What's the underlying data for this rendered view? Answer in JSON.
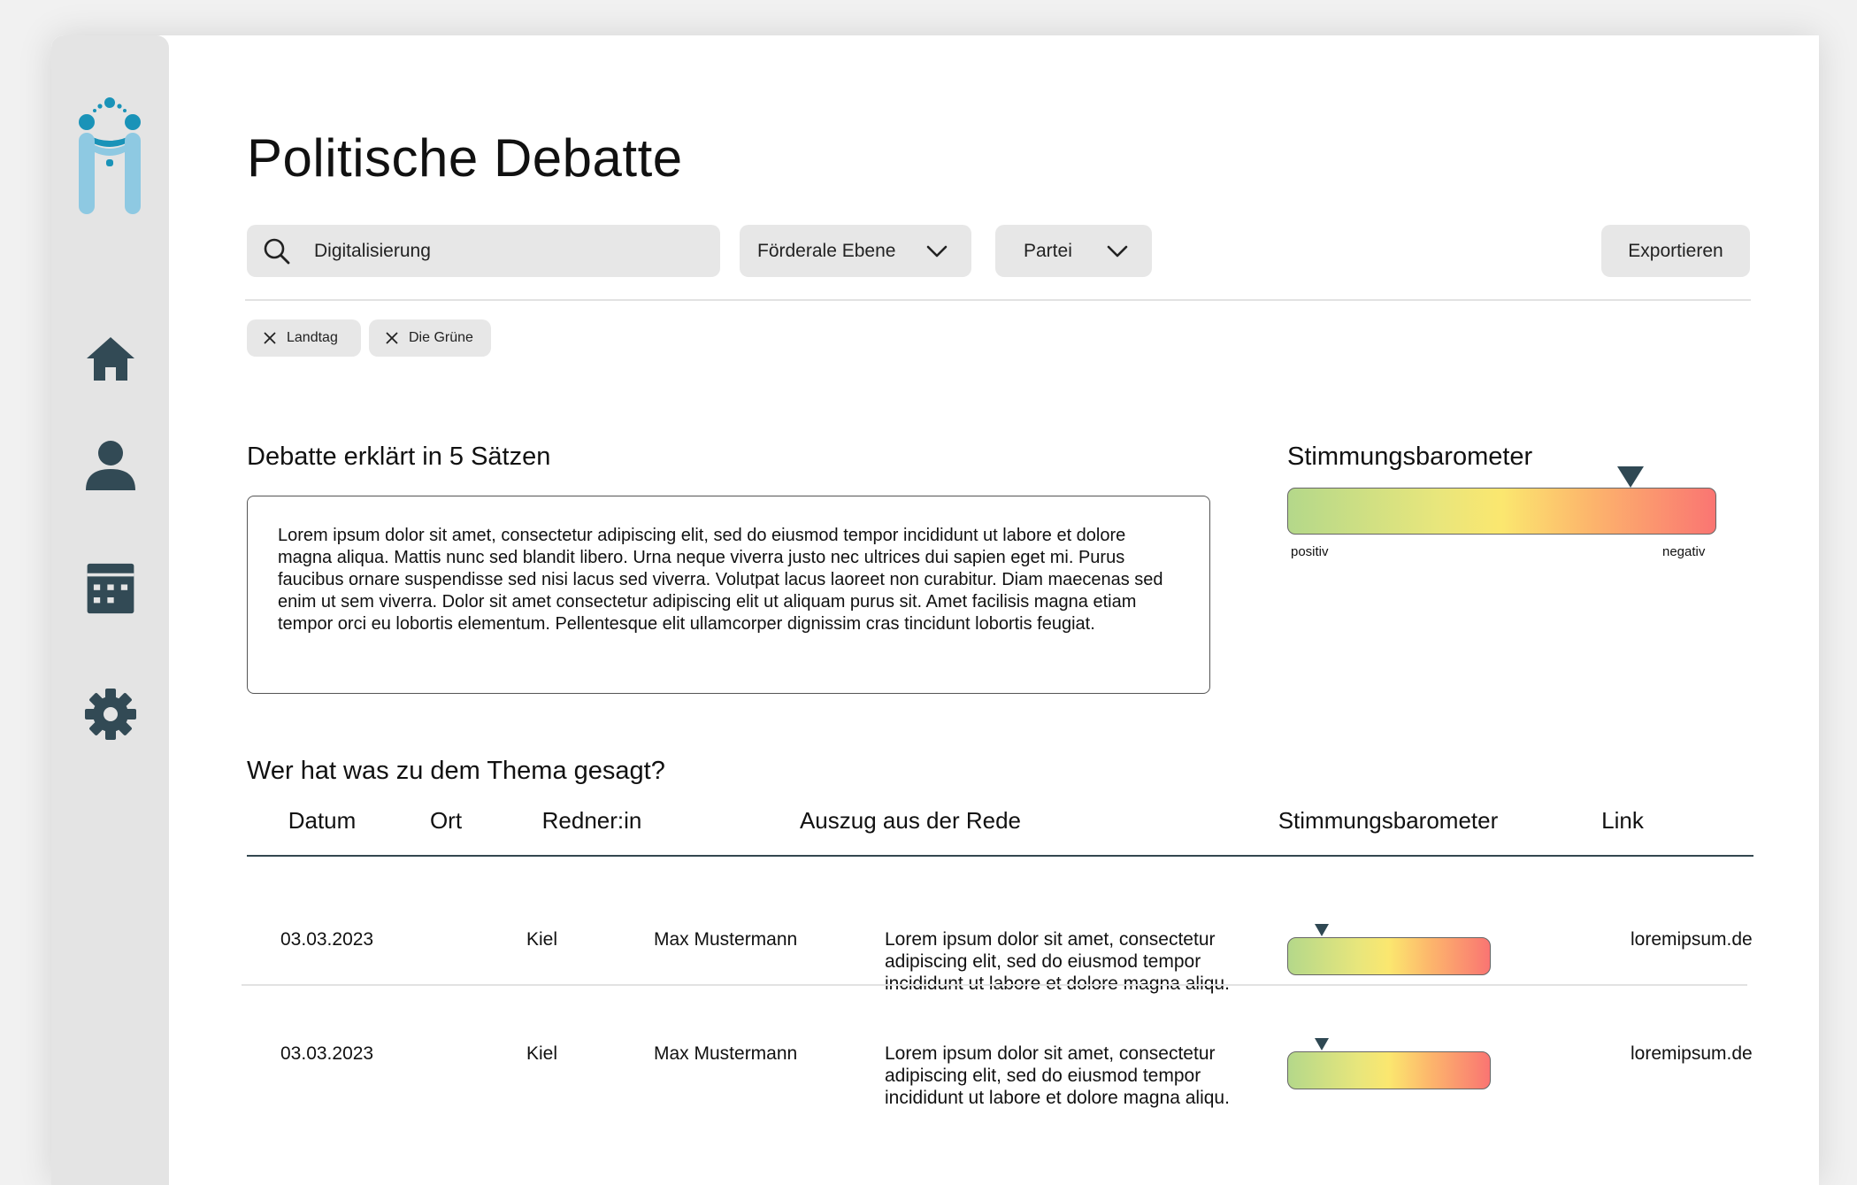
{
  "app": {
    "title": "Politische Debatte",
    "colors": {
      "sidebar_bg": "#e4e4e4",
      "icon_dark": "#324a55",
      "logo_blue_dark": "#1a93b8",
      "logo_blue_light": "#8ec9e2",
      "control_bg": "#e7e7e7",
      "marker": "#2f4853"
    }
  },
  "sidebar": {
    "logo": "logo-icon",
    "items": [
      {
        "icon": "home-icon",
        "name": "sidebar-item-home"
      },
      {
        "icon": "user-icon",
        "name": "sidebar-item-profile"
      },
      {
        "icon": "calendar-icon",
        "name": "sidebar-item-calendar"
      },
      {
        "icon": "gear-icon",
        "name": "sidebar-item-settings"
      }
    ]
  },
  "toolbar": {
    "search": {
      "value": "Digitalisierung",
      "icon": "search-icon"
    },
    "filter_ebene": {
      "label": "Förderale Ebene",
      "icon": "chevron-down-icon"
    },
    "filter_partei": {
      "label": "Partei",
      "icon": "chevron-down-icon"
    },
    "export_label": "Exportieren"
  },
  "chips": [
    {
      "label": "Landtag",
      "icon": "close-icon"
    },
    {
      "label": "Die Grüne",
      "icon": "close-icon"
    }
  ],
  "summary": {
    "title": "Debatte erklärt in 5 Sätzen",
    "text": "Lorem ipsum dolor sit amet, consectetur adipiscing elit, sed do eiusmod tempor incididunt ut labore et dolore magna aliqua. Mattis nunc sed blandit libero. Urna neque viverra justo nec ultrices dui sapien eget mi. Purus faucibus ornare suspendisse sed nisi lacus sed viverra. Volutpat lacus laoreet non curabitur. Diam maecenas sed enim ut sem viverra. Dolor sit amet consectetur adipiscing elit ut aliquam purus sit. Amet facilisis magna etiam tempor orci eu lobortis elementum. Pellentesque elit ullamcorper dignissim cras tincidunt lobortis feugiat."
  },
  "barometer": {
    "title": "Stimmungsbarometer",
    "label_positive": "positiv",
    "label_negative": "negativ",
    "value": 0.8
  },
  "table": {
    "title": "Wer hat was zu dem Thema gesagt?",
    "columns": [
      "Datum",
      "Ort",
      "Redner:in",
      "Auszug aus der Rede",
      "Stimmungsbarometer",
      "Link"
    ],
    "rows": [
      {
        "datum": "03.03.2023",
        "ort": "Kiel",
        "redner": "Max Mustermann",
        "auszug": "Lorem ipsum dolor sit amet, consectetur adipiscing elit, sed do eiusmod tempor incididunt ut labore et dolore magna aliqu.",
        "stimmung": 0.17,
        "link": "loremipsum.de"
      },
      {
        "datum": "03.03.2023",
        "ort": "Kiel",
        "redner": "Max Mustermann",
        "auszug": "Lorem ipsum dolor sit amet, consectetur adipiscing elit, sed do eiusmod tempor incididunt ut labore et dolore magna aliqu.",
        "stimmung": 0.17,
        "link": "loremipsum.de"
      }
    ]
  }
}
